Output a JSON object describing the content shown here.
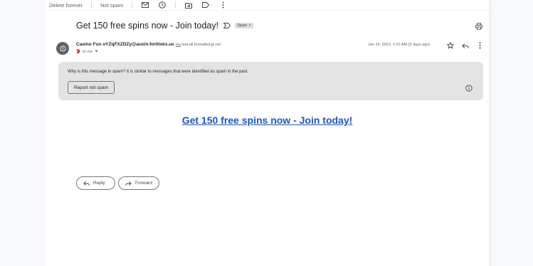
{
  "toolbar": {
    "delete_forever": "Delete forever",
    "not_spam": "Not spam"
  },
  "email": {
    "subject": "Get 150 free spins now - Join today!",
    "label_badge": "Spam",
    "sender_name": "Casino Fun oYZqFXZDZy@auxin.forlitsks.us",
    "via_word": "via",
    "via_domain": "test-all.formalled.jp.net",
    "recipient": "to me",
    "date": "Jan 16, 2023, 1:51 AM (3 days ago)"
  },
  "spam_notice": {
    "text": "Why is this message in spam? It is similar to messages that were identified as spam in the past.",
    "report_button": "Report not spam"
  },
  "body": {
    "headline_link": "Get 150 free spins now - Join today!"
  },
  "actions": {
    "reply": "Reply",
    "forward": "Forward"
  },
  "icons": [
    "mail-icon",
    "clock-icon",
    "move-to-icon",
    "label-icon",
    "more-vert-icon",
    "important-icon",
    "print-icon",
    "star-icon",
    "reply-icon",
    "info-icon",
    "forward-icon"
  ],
  "colors": {
    "link": "#1a56c5",
    "spam_box": "#e3e3e3",
    "badge": "#dddddd"
  }
}
